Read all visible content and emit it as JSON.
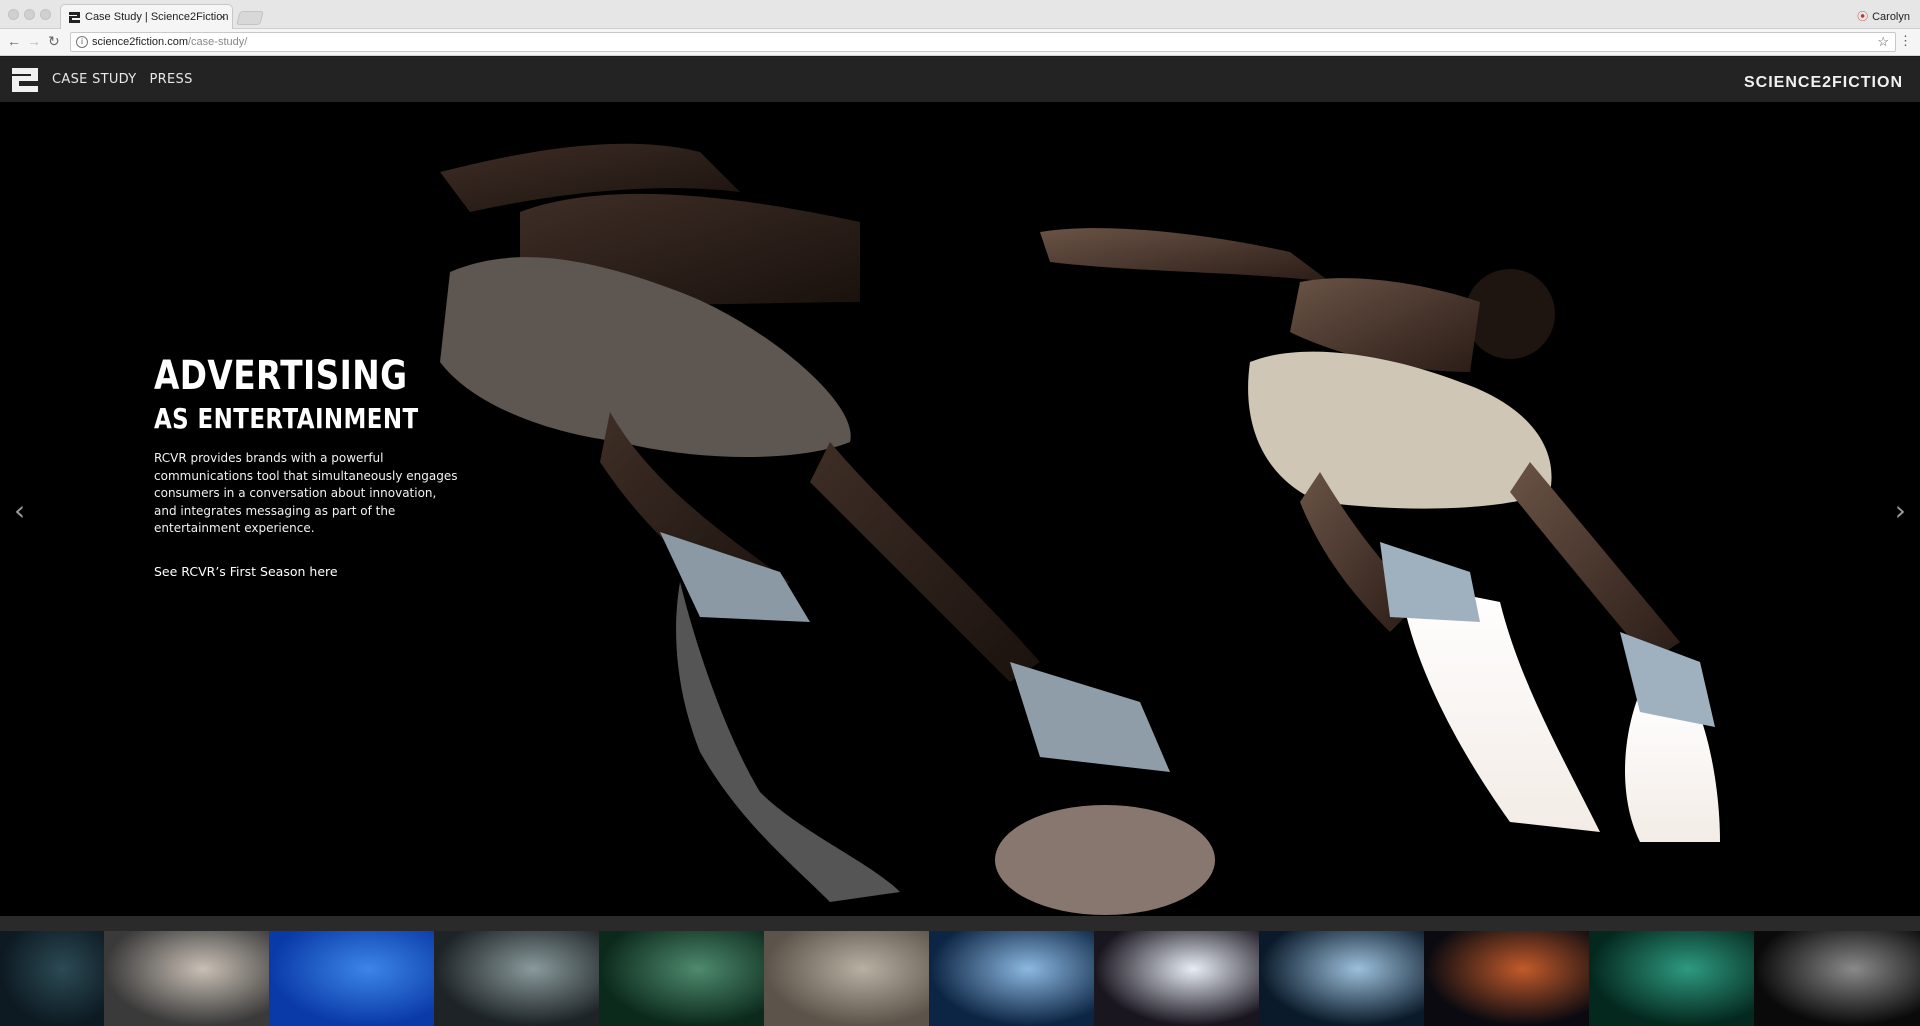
{
  "browser": {
    "tab_title": "Case Study | Science2Fiction",
    "tab_close": "×",
    "profile_name": "Carolyn",
    "url_domain": "science2fiction.com",
    "url_path": "/case-study/"
  },
  "site": {
    "nav": [
      {
        "label": "CASE STUDY"
      },
      {
        "label": "PRESS"
      }
    ],
    "brand": "SCIENCE2FICTION"
  },
  "hero": {
    "title": "ADVERTISING",
    "subtitle": "AS ENTERTAINMENT",
    "body": "RCVR provides brands with a powerful communications tool that simultaneously engages consumers in a conversation about innovation, and integrates messaging as part of the entertainment experience.",
    "link": "See RCVR’s First Season here",
    "prev_arrow": "‹",
    "next_arrow": "›"
  },
  "thumbnails": [
    {
      "colors": [
        "#0d1a22",
        "#2c4a55"
      ]
    },
    {
      "colors": [
        "#3a3a3a",
        "#c9c0b5"
      ]
    },
    {
      "colors": [
        "#0a3aa8",
        "#3c86e8"
      ]
    },
    {
      "colors": [
        "#1d2326",
        "#8a9a9c"
      ]
    },
    {
      "colors": [
        "#0c2a1c",
        "#4e8a6e"
      ]
    },
    {
      "colors": [
        "#5c544a",
        "#b8b0a2"
      ]
    },
    {
      "colors": [
        "#0c2544",
        "#8cb8e0"
      ]
    },
    {
      "colors": [
        "#1a1620",
        "#e8eef5"
      ]
    },
    {
      "colors": [
        "#0a1a2a",
        "#9cc0dc"
      ]
    },
    {
      "colors": [
        "#0a0a10",
        "#c25a2a"
      ]
    },
    {
      "colors": [
        "#04281e",
        "#2e9a80"
      ]
    },
    {
      "colors": [
        "#0a0a0a",
        "#8a8a8a"
      ]
    }
  ]
}
